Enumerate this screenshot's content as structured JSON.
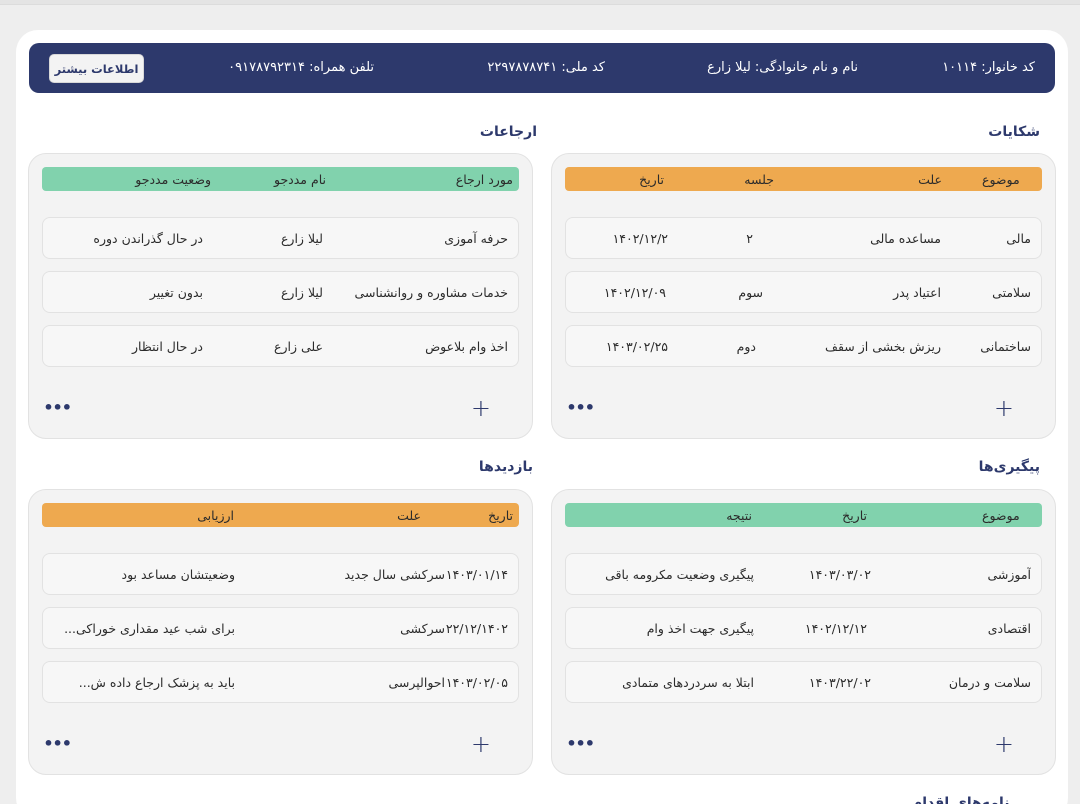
{
  "header": {
    "family_code": "کد خانوار: ۱۰۱۱۴",
    "full_name": "نام و نام خانوادگی: لیلا زارع",
    "national_code": "کد ملی: ۲۲۹۷۸۷۸۷۴۱",
    "mobile": "تلفن همراه: ۰۹۱۷۸۷۹۲۳۱۴",
    "more_button": "اطلاعات بیشتر"
  },
  "complaints": {
    "title": "شکایات",
    "columns": [
      "موضوع",
      "علت",
      "جلسه",
      "تاریخ"
    ],
    "rows": [
      [
        "مالی",
        "مساعده مالی",
        "۲",
        "۱۴۰۲/۱۲/۲"
      ],
      [
        "سلامتی",
        "اعتیاد پدر",
        "سوم",
        "۱۴۰۲/۱۲/۰۹"
      ],
      [
        "ساختمانی",
        "ریزش بخشی از سقف",
        "دوم",
        "۱۴۰۳/۰۲/۲۵"
      ]
    ]
  },
  "referrals": {
    "title": "ارجاعات",
    "columns": [
      "مورد ارجاع",
      "نام مددجو",
      "وضعیت مددجو"
    ],
    "rows": [
      [
        "حرفه آموزی",
        "لیلا زارع",
        "در حال گذراندن دوره"
      ],
      [
        "خدمات مشاوره و روانشناسی",
        "لیلا زارع",
        "بدون تغییر"
      ],
      [
        "اخذ وام بلاعوض",
        "علی زارع",
        "در حال انتظار"
      ]
    ]
  },
  "followups": {
    "title": "پیگیری‌ها",
    "columns": [
      "موضوع",
      "تاریخ",
      "نتیجه"
    ],
    "rows": [
      [
        "آموزشی",
        "۱۴۰۳/۰۳/۰۲",
        "پیگیری وضعیت مکرومه باقی"
      ],
      [
        "اقتصادی",
        "۱۴۰۲/۱۲/۱۲",
        "پیگیری جهت اخذ وام"
      ],
      [
        "سلامت و درمان",
        "۱۴۰۳/۲۲/۰۲",
        "ابتلا به سردردهای متمادی"
      ]
    ]
  },
  "visits": {
    "title": "بازدیدها",
    "columns": [
      "تاریخ",
      "علت",
      "ارزیابی"
    ],
    "rows": [
      [
        "۱۴۰۳/۰۱/۱۴",
        "سرکشی سال جدید",
        "وضعیتشان مساعد بود"
      ],
      [
        "۲۲/۱۲/۱۴۰۲",
        "سرکشی",
        "برای شب عید مقداری خوراکی..."
      ],
      [
        "۱۴۰۳/۰۲/۰۵",
        "احوالپرسی",
        "باید به پزشک ارجاع داده ش..."
      ]
    ]
  },
  "actions": {
    "add_symbol": "+",
    "more_symbol": "•••"
  },
  "bottom_section_title": "نامه‌های اقدام"
}
